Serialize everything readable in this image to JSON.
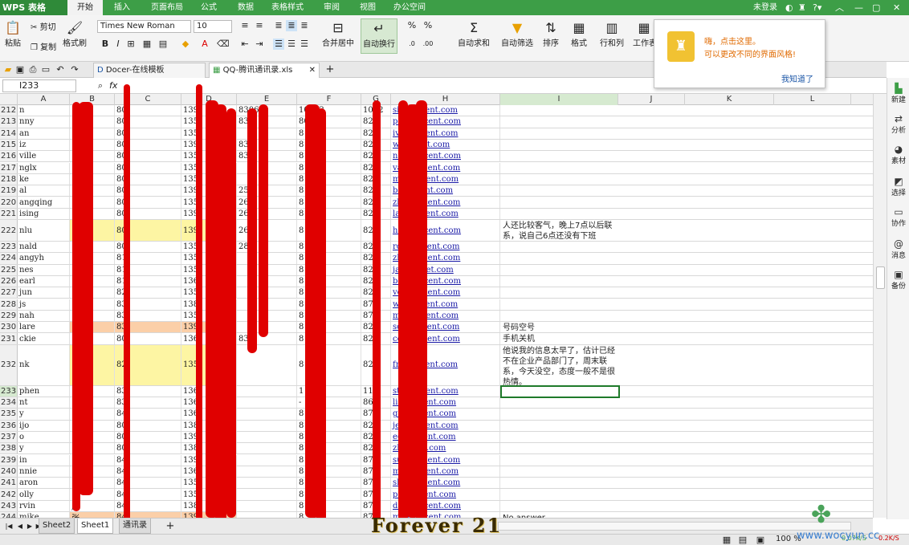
{
  "app": {
    "logo": "WPS 表格",
    "hint": "未登录"
  },
  "menu": [
    "开始",
    "插入",
    "页面布局",
    "公式",
    "数据",
    "表格样式",
    "审阅",
    "视图",
    "办公空间"
  ],
  "ribbon": {
    "paste": "粘贴",
    "cut": "剪切",
    "copy": "复制",
    "format_painter": "格式刷",
    "font": "Times New Roman",
    "size": "10",
    "merge": "合并居中",
    "wrap": "自动换行",
    "sum": "自动求和",
    "filter": "自动筛选",
    "sort": "排序",
    "format": "格式",
    "rowcol": "行和列",
    "worksheet": "工作表"
  },
  "doc_tabs": [
    "Docer-在线模板",
    "QQ-腾讯通讯录.xls"
  ],
  "formula": {
    "name_box": "I233",
    "fx": "fx"
  },
  "columns": [
    "A",
    "B",
    "C",
    "D",
    "E",
    "F",
    "G",
    "H",
    "I",
    "J",
    "K",
    "L"
  ],
  "selected_column": "I",
  "rows": [
    {
      "n": "212",
      "a": "n",
      "b": "",
      "c": "80",
      "e": "139",
      "f": "83060",
      "g": "10062",
      "h": "1062",
      "email": "si@tencent.com",
      "fill": ""
    },
    {
      "n": "213",
      "a": "nny",
      "c": "80",
      "e": "135",
      "f": "83",
      "g": "80207",
      "h": "82",
      "email": "pe@tencent.com",
      "fill": ""
    },
    {
      "n": "214",
      "a": "an",
      "c": "80",
      "e": "135",
      "f": "",
      "g": "8",
      "h": "82",
      "email": "iv@tencent.com",
      "fill": ""
    },
    {
      "n": "215",
      "a": "iz",
      "c": "80",
      "e": "139",
      "f": "83",
      "g": "8",
      "h": "82",
      "email": "w@ncent.com",
      "fill": ""
    },
    {
      "n": "216",
      "a": "ville",
      "c": "80",
      "e": "135",
      "f": "83",
      "g": "8",
      "h": "82",
      "email": "ne@tencent.com",
      "fill": ""
    },
    {
      "n": "217",
      "a": "nglx",
      "c": "80",
      "e": "135",
      "f": "",
      "g": "8",
      "h": "82",
      "email": "va@tencent.com",
      "fill": ""
    },
    {
      "n": "218",
      "a": "ke",
      "c": "80",
      "e": "135",
      "f": "",
      "g": "8",
      "h": "82",
      "email": "m@tencent.com",
      "fill": ""
    },
    {
      "n": "219",
      "a": "al",
      "c": "80",
      "e": "139",
      "f": "25",
      "g": "8",
      "h": "82",
      "email": "ba@ncent.com",
      "fill": ""
    },
    {
      "n": "220",
      "a": "angqing",
      "c": "80",
      "e": "135",
      "f": "26",
      "g": "8",
      "h": "82",
      "email": "zh@tencent.com",
      "fill": ""
    },
    {
      "n": "221",
      "a": "ising",
      "c": "80",
      "e": "139",
      "f": "26",
      "g": "8",
      "h": "82",
      "email": "la@tencent.com",
      "fill": ""
    },
    {
      "n": "222",
      "a": "nlu",
      "c": "80",
      "e": "139",
      "f": "26",
      "g": "8",
      "h": "82",
      "email": "ha@tencent.com",
      "fill": "#fdf5a3",
      "note": "人还比较客气，晚上7点以后联系，说自己6点还没有下班",
      "tall": 27
    },
    {
      "n": "223",
      "a": "nald",
      "c": "80",
      "e": "135",
      "f": "28",
      "g": "8",
      "h": "82",
      "email": "ro@tencent.com",
      "fill": ""
    },
    {
      "n": "224",
      "a": "angyh",
      "c": "81",
      "e": "135",
      "f": "",
      "g": "8",
      "h": "82",
      "email": "zh@tencent.com",
      "fill": ""
    },
    {
      "n": "225",
      "a": "nes",
      "c": "81",
      "e": "135",
      "f": "",
      "g": "8",
      "h": "82",
      "email": "ja@tncnet.com",
      "fill": ""
    },
    {
      "n": "226",
      "a": "earl",
      "c": "81",
      "e": "136",
      "f": "",
      "g": "8",
      "h": "82",
      "email": "be@tencent.com",
      "fill": ""
    },
    {
      "n": "227",
      "a": "jun",
      "c": "82",
      "e": "135",
      "f": "",
      "g": "8",
      "h": "82",
      "email": "ve@tencent.com",
      "fill": ""
    },
    {
      "n": "228",
      "a": "js",
      "c": "83",
      "e": "138",
      "f": "",
      "g": "8",
      "h": "87",
      "email": "w@tencent.com",
      "fill": ""
    },
    {
      "n": "229",
      "a": "nah",
      "c": "83",
      "e": "135",
      "f": "",
      "g": "8",
      "h": "87",
      "email": "m@tencent.com",
      "fill": ""
    },
    {
      "n": "230",
      "a": "lare",
      "c": "83",
      "e": "139",
      "f": "",
      "g": "8",
      "h": "82",
      "email": "sc@tencent.com",
      "fill": "#fbcfa8",
      "note": "号码空号"
    },
    {
      "n": "231",
      "a": "ckie",
      "c": "80",
      "e": "136",
      "f": "83",
      "g": "8",
      "h": "82",
      "email": "cc@tencent.com",
      "fill": "",
      "note": "手机关机"
    },
    {
      "n": "232",
      "a": "nk",
      "c": "82",
      "e": "135",
      "f": "",
      "g": "8",
      "h": "82",
      "email": "fr@tencent.com",
      "fill": "#fdf5a3",
      "note": "他说我的信息太早了，估计已经不在企业产品部门了，周末联系，今天没空，态度一般不是很热情。",
      "tall": 51
    },
    {
      "n": "233",
      "a": "phen",
      "c": "83",
      "e": "136",
      "f": "",
      "g": "1",
      "h": "11",
      "email": "st@tencent.com",
      "fill": ""
    },
    {
      "n": "234",
      "a": "nt",
      "c": "83",
      "e": "136",
      "f": "",
      "g": "-",
      "h": "86",
      "email": "li@tencent.com",
      "fill": ""
    },
    {
      "n": "235",
      "a": "y",
      "c": "84",
      "e": "136",
      "f": "",
      "g": "8",
      "h": "87",
      "email": "g@tencent.com",
      "fill": ""
    },
    {
      "n": "236",
      "a": "ijo",
      "c": "80",
      "e": "138",
      "f": "",
      "g": "8",
      "h": "82",
      "email": "je@tencent.com",
      "fill": ""
    },
    {
      "n": "237",
      "a": "o",
      "c": "80",
      "e": "139",
      "f": "",
      "g": "8",
      "h": "82",
      "email": "e@tencent.com",
      "fill": ""
    },
    {
      "n": "238",
      "a": "y",
      "c": "80",
      "e": "138",
      "f": "",
      "g": "8",
      "h": "82",
      "email": "zh@tent.com",
      "fill": ""
    },
    {
      "n": "239",
      "a": "in",
      "c": "84",
      "e": "139",
      "f": "",
      "g": "8",
      "h": "87",
      "email": "su@tencent.com",
      "fill": ""
    },
    {
      "n": "240",
      "a": "nnie",
      "c": "84",
      "e": "136",
      "f": "",
      "g": "8",
      "h": "87",
      "email": "m@tencent.com",
      "fill": ""
    },
    {
      "n": "241",
      "a": "aron",
      "c": "84",
      "e": "135",
      "f": "",
      "g": "8",
      "h": "87",
      "email": "sh@tencent.com",
      "fill": ""
    },
    {
      "n": "242",
      "a": "olly",
      "c": "84",
      "e": "135",
      "f": "",
      "g": "8",
      "h": "87",
      "email": "p@tencent.com",
      "fill": ""
    },
    {
      "n": "243",
      "a": "rvin",
      "b": "唐",
      "c": "84",
      "e": "138",
      "f": "",
      "g": "8",
      "h": "87",
      "email": "da@tencent.com",
      "fill": ""
    },
    {
      "n": "244",
      "a": "mike",
      "b": "张",
      "c": "84",
      "e": "139",
      "f": "",
      "g": "8",
      "h": "87",
      "email": "mi@tencent.com",
      "fill": "#fbcfa8",
      "note": "No answer"
    }
  ],
  "sheets": [
    "Sheet2",
    "Sheet1",
    "通讯录"
  ],
  "active_sheet": "Sheet1",
  "sidebar": [
    "新建",
    "分析",
    "素材",
    "选择",
    "协作",
    "消息",
    "备份"
  ],
  "popup": {
    "line1": "嗨，点击这里。",
    "line2": "可以更改不同的界面风格!",
    "ok": "我知道了"
  },
  "status": {
    "zoom": "100 %",
    "net_up": "0.07K/S",
    "net_down": "0.2K/S"
  },
  "watermark": "Forever 21",
  "site": "www.wocyun.cc"
}
